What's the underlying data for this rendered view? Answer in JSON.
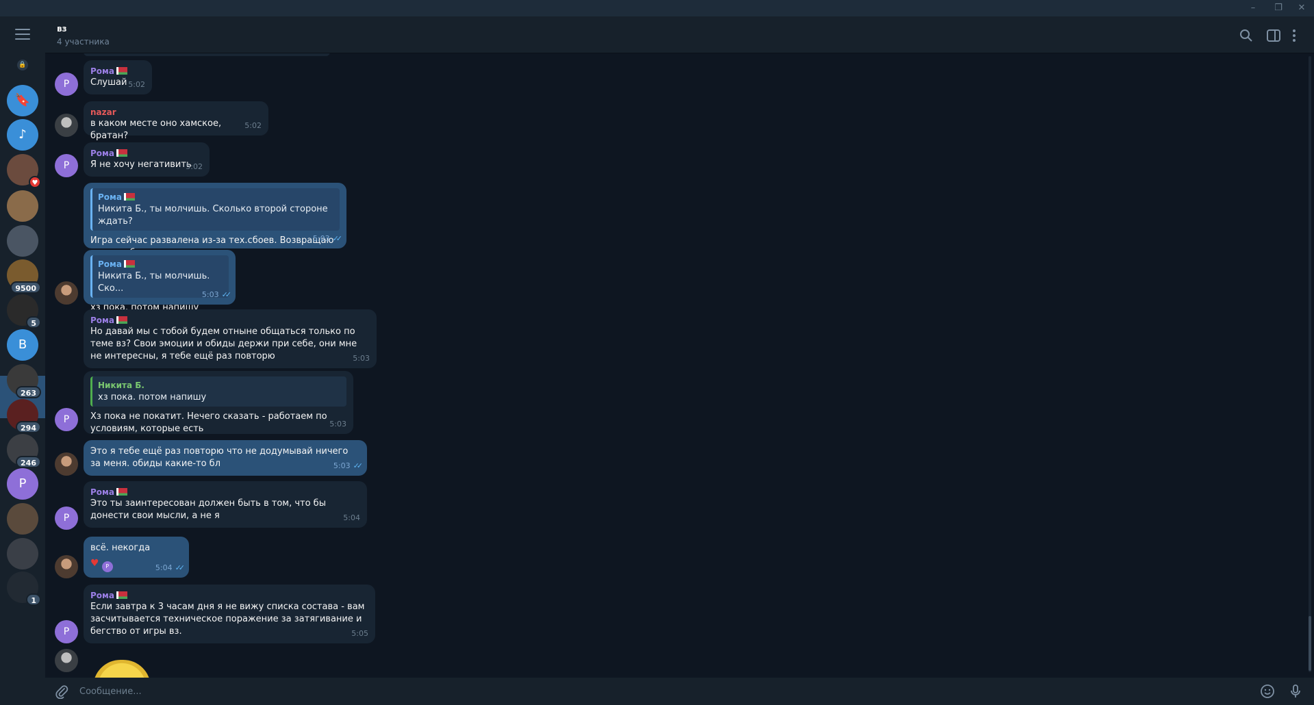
{
  "window": {
    "minimize": "–",
    "restore": "❐",
    "close": "✕"
  },
  "sidebar": {
    "chats": [
      {
        "name": "saved-messages",
        "color": "#3a8fd8",
        "glyph": "🔖"
      },
      {
        "name": "music",
        "color": "#3a8fd8",
        "glyph": "♪"
      },
      {
        "name": "chat-3",
        "color": "#6b4b3e",
        "heart": "♥"
      },
      {
        "name": "chat-4",
        "color": "#8a6b4a"
      },
      {
        "name": "chat-5",
        "color": "#4a5563"
      },
      {
        "name": "chat-6",
        "color": "#7a5b2e",
        "badge": "9500"
      },
      {
        "name": "chat-7",
        "color": "#2a2a2a",
        "badge": "5"
      },
      {
        "name": "chat-8",
        "color": "#3a8fd8",
        "letter": "В"
      },
      {
        "name": "chat-9",
        "color": "#3a3a3a",
        "badge": "263"
      },
      {
        "name": "chat-10",
        "color": "#5a2020",
        "badge": "294"
      },
      {
        "name": "chat-11",
        "color": "#3c3f44",
        "badge": "246"
      },
      {
        "name": "chat-12",
        "color": "#8e6fd8",
        "letter": "Р"
      },
      {
        "name": "chat-13",
        "color": "#5a4a3c"
      },
      {
        "name": "chat-14",
        "color": "#3a3f47"
      },
      {
        "name": "chat-15",
        "color": "#222a33",
        "badge": "1"
      }
    ]
  },
  "header": {
    "title": "вз",
    "subtitle": "4 участника"
  },
  "messages": [
    {
      "sender": "Рома",
      "text": "Слушай",
      "time": "5:02"
    },
    {
      "sender": "nazar",
      "text": "в каком месте оно хамское, братан?",
      "time": "5:02"
    },
    {
      "sender": "Рома",
      "text": "Я не хочу негативить",
      "time": "5:02"
    },
    {
      "quote_name": "Рома",
      "quote_text": "Никита Б., ты молчишь. Сколько второй стороне ждать?",
      "text": "Игра сейчас развалена из-за тех.сбоев. Возвращаю состав обратно в кучку пока",
      "time": "5:03"
    },
    {
      "quote_name": "Рома",
      "quote_text": "Никита Б., ты молчишь. Ско...",
      "text": "хз пока. потом напишу",
      "time": "5:03"
    },
    {
      "sender": "Рома",
      "text": "Но давай мы с тобой будем отныне общаться только по теме вз? Свои эмоции и обиды держи при себе, они мне не интересны, я тебе ещё раз повторю",
      "time": "5:03"
    },
    {
      "quote_name": "Никита Б.",
      "quote_text": "хз пока. потом напишу",
      "text": "Хз пока не покатит. Нечего сказать - работаем по условиям, которые есть",
      "time": "5:03"
    },
    {
      "text": "Это я тебе ещё раз повторю что не додумывай ничего за меня. обиды какие-то бл",
      "time": "5:03"
    },
    {
      "sender": "Рома",
      "text": "Это ты заинтересован должен быть в том, что бы донести свои мысли, а не я",
      "time": "5:04"
    },
    {
      "text": "всё. некогда",
      "time": "5:04",
      "react_heart": "♥",
      "react_av": "Р"
    },
    {
      "sender": "Рома",
      "text": "Если завтра к 3 часам дня я не вижу списка состава - вам засчитывается техническое поражение за затягивание и бегство от игры вз.",
      "time": "5:05"
    }
  ],
  "avatars": {
    "roma_letter": "Р"
  },
  "composer": {
    "placeholder": "Сообщение..."
  }
}
